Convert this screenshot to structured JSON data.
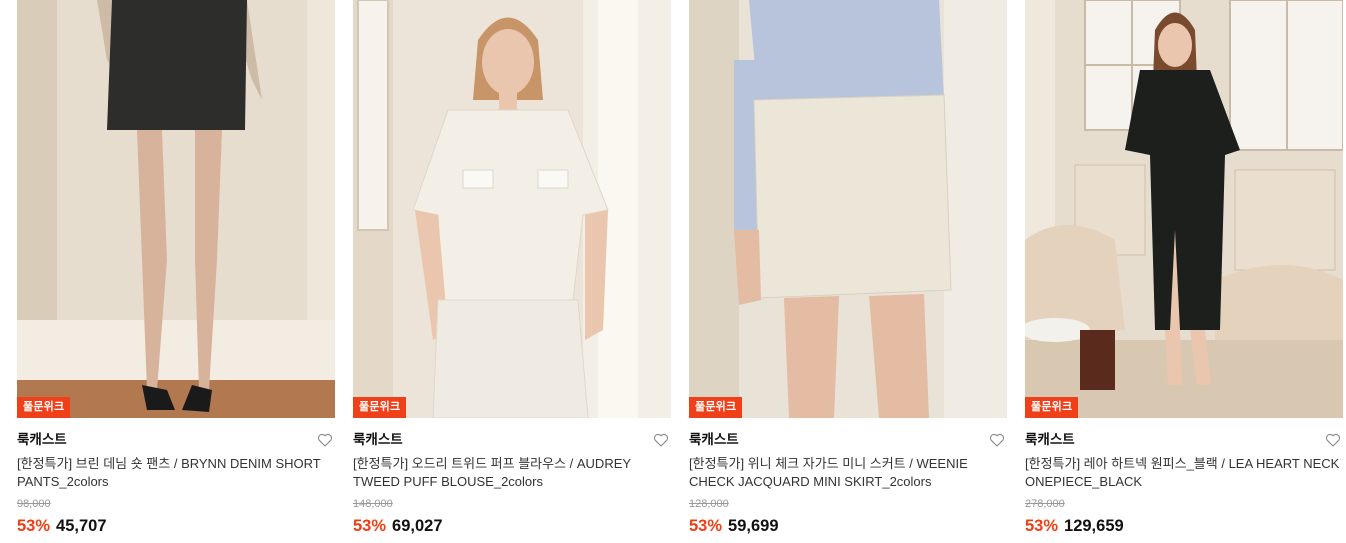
{
  "colors": {
    "badge_bg": "#f0401a",
    "discount": "#f03e14",
    "wish_icon": "#8a8a8a"
  },
  "products": [
    {
      "badge": "풀문위크",
      "brand": "룩캐스트",
      "title": "[한정특가] 브린 데님 숏 팬츠 / BRYNN DENIM SHORT PANTS_2colors",
      "original_price": "98,000",
      "discount_rate": "53%",
      "sale_price": "45,707",
      "wish_icon": "heart-outline-icon"
    },
    {
      "badge": "풀문위크",
      "brand": "룩캐스트",
      "title": "[한정특가] 오드리 트위드 퍼프 블라우스 / AUDREY TWEED PUFF BLOUSE_2colors",
      "original_price": "148,000",
      "discount_rate": "53%",
      "sale_price": "69,027",
      "wish_icon": "heart-outline-icon"
    },
    {
      "badge": "풀문위크",
      "brand": "룩캐스트",
      "title": "[한정특가] 위니 체크 자가드 미니 스커트 / WEENIE CHECK JACQUARD MINI SKIRT_2colors",
      "original_price": "128,000",
      "discount_rate": "53%",
      "sale_price": "59,699",
      "wish_icon": "heart-outline-icon"
    },
    {
      "badge": "풀문위크",
      "brand": "룩캐스트",
      "title": "[한정특가] 레아 하트넥 원피스_블랙 / LEA HEART NECK ONEPIECE_BLACK",
      "original_price": "278,000",
      "discount_rate": "53%",
      "sale_price": "129,659",
      "wish_icon": "heart-outline-icon"
    }
  ]
}
